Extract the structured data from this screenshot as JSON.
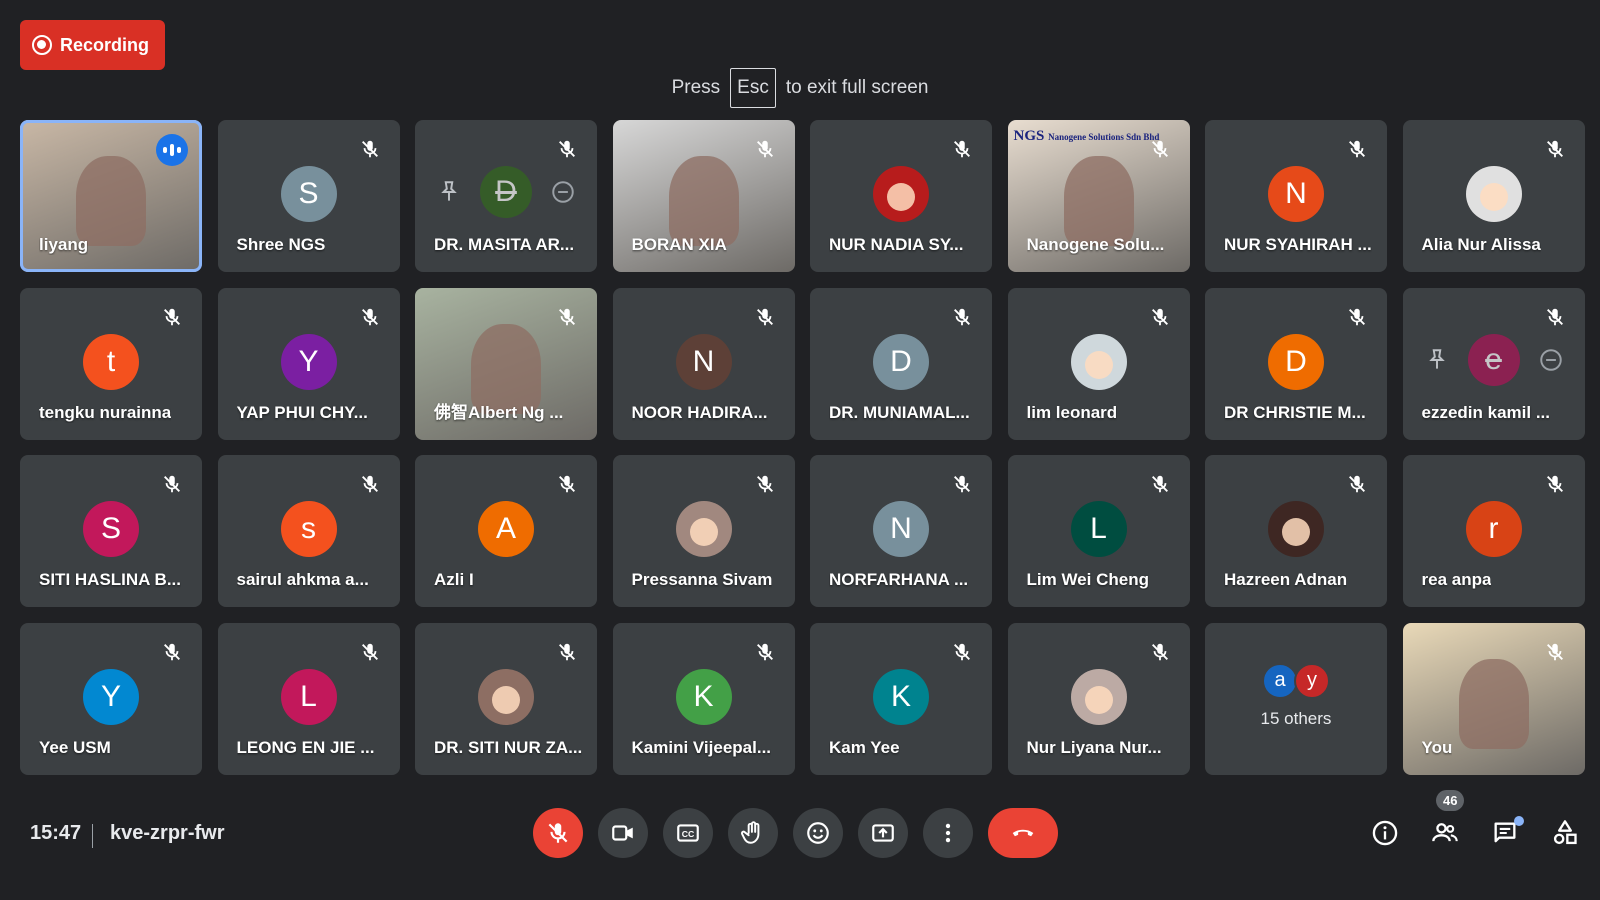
{
  "recording": {
    "label": "Recording"
  },
  "fullscreen": {
    "press": "Press",
    "key": "Esc",
    "rest": "to exit full screen"
  },
  "tiles": [
    {
      "name": "liyang",
      "type": "video",
      "speaking": true,
      "bg": "#c9b8a6"
    },
    {
      "name": "Shree NGS",
      "type": "avatar",
      "letter": "S",
      "color": "#78909c"
    },
    {
      "name": "DR. MASITA AR...",
      "type": "pinned",
      "letter": "D",
      "color": "#33691e"
    },
    {
      "name": "BORAN XIA",
      "type": "video",
      "bg": "#d7d7d7"
    },
    {
      "name": "NUR NADIA SY...",
      "type": "photo",
      "color": "#b71c1c"
    },
    {
      "name": "Nanogene Solu...",
      "type": "video",
      "bg": "#e8ddd0",
      "logo_text": "NGS",
      "logo_sub": "Nanogene Solutions Sdn Bhd"
    },
    {
      "name": "NUR SYAHIRAH ...",
      "type": "avatar",
      "letter": "N",
      "color": "#e64a19"
    },
    {
      "name": "Alia Nur Alissa",
      "type": "photo",
      "color": "#e0e0e0"
    },
    {
      "name": "tengku nurainna",
      "type": "avatar",
      "letter": "t",
      "color": "#f4511e"
    },
    {
      "name": "YAP PHUI CHY...",
      "type": "avatar",
      "letter": "Y",
      "color": "#7b1fa2"
    },
    {
      "name": "佛智Albert Ng ...",
      "type": "video",
      "bg": "#a8b3a0"
    },
    {
      "name": "NOOR HADIRA...",
      "type": "avatar",
      "letter": "N",
      "color": "#5d4037"
    },
    {
      "name": "DR. MUNIAMAL...",
      "type": "avatar",
      "letter": "D",
      "color": "#78909c"
    },
    {
      "name": "lim leonard",
      "type": "photo",
      "color": "#cfd8dc"
    },
    {
      "name": "DR CHRISTIE M...",
      "type": "avatar",
      "letter": "D",
      "color": "#ef6c00"
    },
    {
      "name": "ezzedin kamil ...",
      "type": "pinned",
      "letter": "e",
      "color": "#ad1457"
    },
    {
      "name": "SITI HASLINA B...",
      "type": "avatar",
      "letter": "S",
      "color": "#c2185b"
    },
    {
      "name": "sairul ahkma a...",
      "type": "avatar",
      "letter": "s",
      "color": "#f4511e"
    },
    {
      "name": "Azli I",
      "type": "avatar",
      "letter": "A",
      "color": "#ef6c00"
    },
    {
      "name": "Pressanna Sivam",
      "type": "photo",
      "color": "#a1887f"
    },
    {
      "name": "NORFARHANA ...",
      "type": "avatar",
      "letter": "N",
      "color": "#78909c"
    },
    {
      "name": "Lim Wei Cheng",
      "type": "avatar",
      "letter": "L",
      "color": "#004d40"
    },
    {
      "name": "Hazreen Adnan",
      "type": "photo",
      "color": "#3e2723"
    },
    {
      "name": "rea anpa",
      "type": "avatar",
      "letter": "r",
      "color": "#d84315"
    },
    {
      "name": "Yee USM",
      "type": "avatar",
      "letter": "Y",
      "color": "#0288d1"
    },
    {
      "name": "LEONG EN JIE ...",
      "type": "avatar",
      "letter": "L",
      "color": "#c2185b"
    },
    {
      "name": "DR. SITI NUR ZA...",
      "type": "photo",
      "color": "#8d6e63"
    },
    {
      "name": "Kamini Vijeepal...",
      "type": "avatar",
      "letter": "K",
      "color": "#43a047"
    },
    {
      "name": "Kam Yee",
      "type": "avatar",
      "letter": "K",
      "color": "#00838f"
    },
    {
      "name": "Nur Liyana Nur...",
      "type": "photo",
      "color": "#bcaaa4"
    },
    {
      "name": "",
      "type": "others",
      "label": "15 others",
      "mini": [
        {
          "letter": "a",
          "color": "#1565c0"
        },
        {
          "letter": "y",
          "color": "#c62828"
        }
      ]
    },
    {
      "name": "You",
      "type": "video",
      "bg": "#e9d9b8"
    }
  ],
  "bottom": {
    "time": "15:47",
    "meeting_code": "kve-zrpr-fwr",
    "participants_count": "46"
  }
}
